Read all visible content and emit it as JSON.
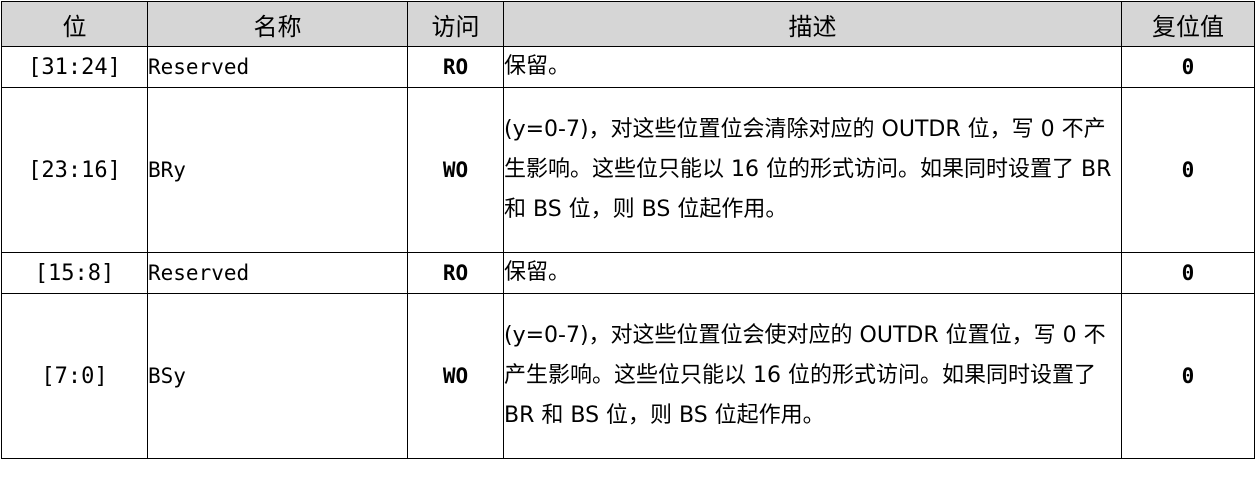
{
  "headers": {
    "bits": "位",
    "name": "名称",
    "access": "访问",
    "description": "描述",
    "reset": "复位值"
  },
  "rows": [
    {
      "bits": "[31:24]",
      "name": "Reserved",
      "access": "RO",
      "description": "保留。",
      "reset": "0"
    },
    {
      "bits": "[23:16]",
      "name": "BRy",
      "access": "WO",
      "description": "(y=0-7)，对这些位置位会清除对应的 OUTDR 位，写 0 不产生影响。这些位只能以 16 位的形式访问。如果同时设置了 BR 和 BS 位，则 BS 位起作用。",
      "reset": "0"
    },
    {
      "bits": "[15:8]",
      "name": "Reserved",
      "access": "RO",
      "description": "保留。",
      "reset": "0"
    },
    {
      "bits": "[7:0]",
      "name": "BSy",
      "access": "WO",
      "description": "(y=0-7)，对这些位置位会使对应的 OUTDR 位置位，写 0 不产生影响。这些位只能以 16 位的形式访问。如果同时设置了 BR 和 BS 位，则 BS 位起作用。",
      "reset": "0"
    }
  ]
}
